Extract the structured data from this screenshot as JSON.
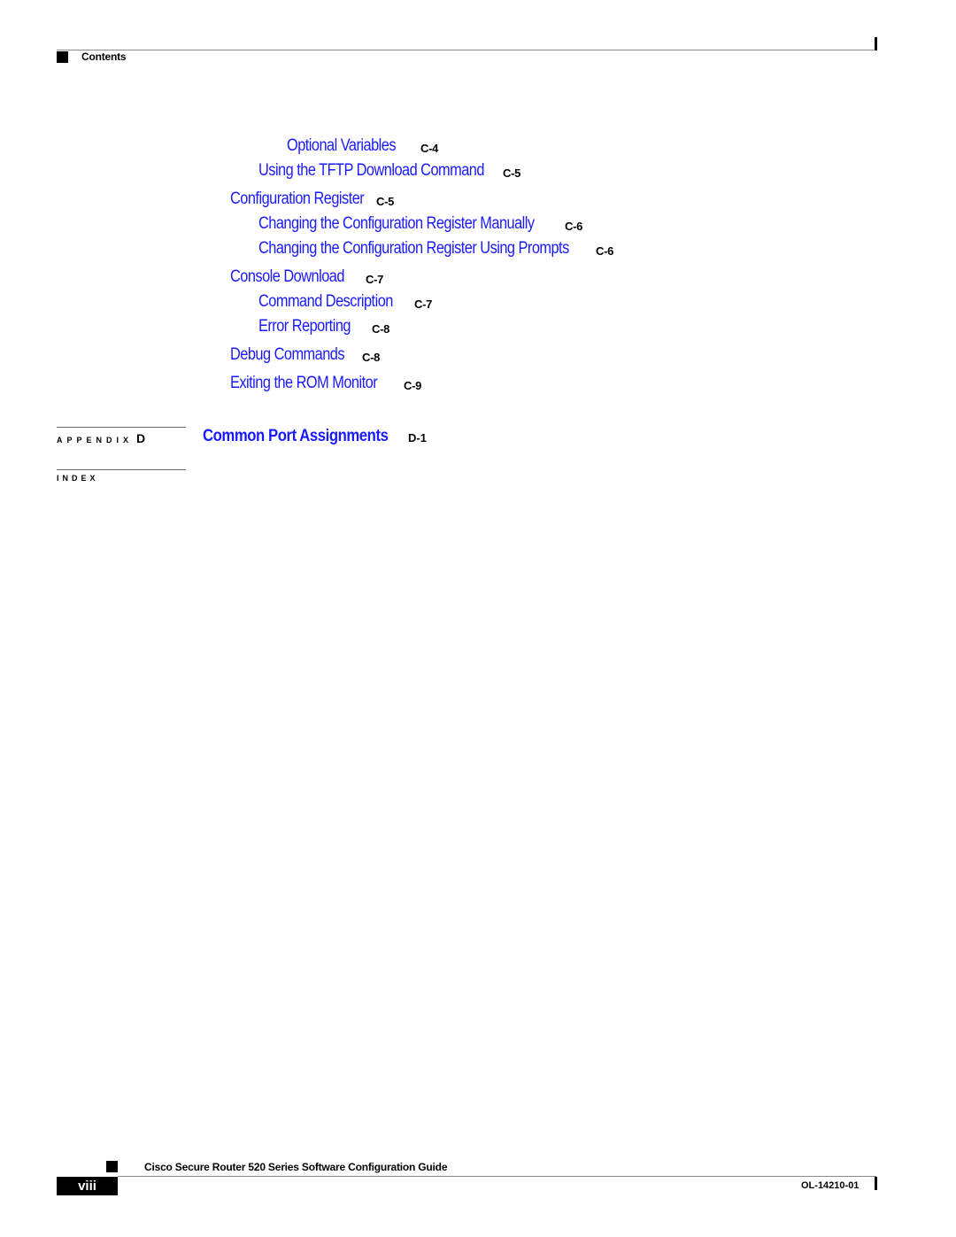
{
  "header": {
    "section_title": "Contents"
  },
  "toc_entries": [
    {
      "title": "Optional Variables",
      "page": "C-4",
      "level": 3
    },
    {
      "title": "Using the TFTP Download Command",
      "page": "C-5",
      "level": 2
    },
    {
      "title": "Configuration Register",
      "page": "C-5",
      "level": 1
    },
    {
      "title": "Changing the Configuration Register Manually",
      "page": "C-6",
      "level": 2
    },
    {
      "title": "Changing the Configuration Register Using Prompts",
      "page": "C-6",
      "level": 2
    },
    {
      "title": "Console Download",
      "page": "C-7",
      "level": 1
    },
    {
      "title": "Command Description",
      "page": "C-7",
      "level": 2
    },
    {
      "title": "Error Reporting",
      "page": "C-8",
      "level": 2
    },
    {
      "title": "Debug Commands",
      "page": "C-8",
      "level": 1
    },
    {
      "title": "Exiting the ROM Monitor",
      "page": "C-9",
      "level": 1
    }
  ],
  "appendix": {
    "label": "APPENDIX",
    "letter": "D",
    "title": "Common Port Assignments",
    "page": "D-1"
  },
  "index": {
    "label": "INDEX"
  },
  "footer": {
    "guide_title": "Cisco Secure Router 520 Series Software Configuration Guide",
    "page_number": "viii",
    "doc_number": "OL-14210-01"
  },
  "colors": {
    "link": "#1a1aff",
    "text": "#000000"
  }
}
